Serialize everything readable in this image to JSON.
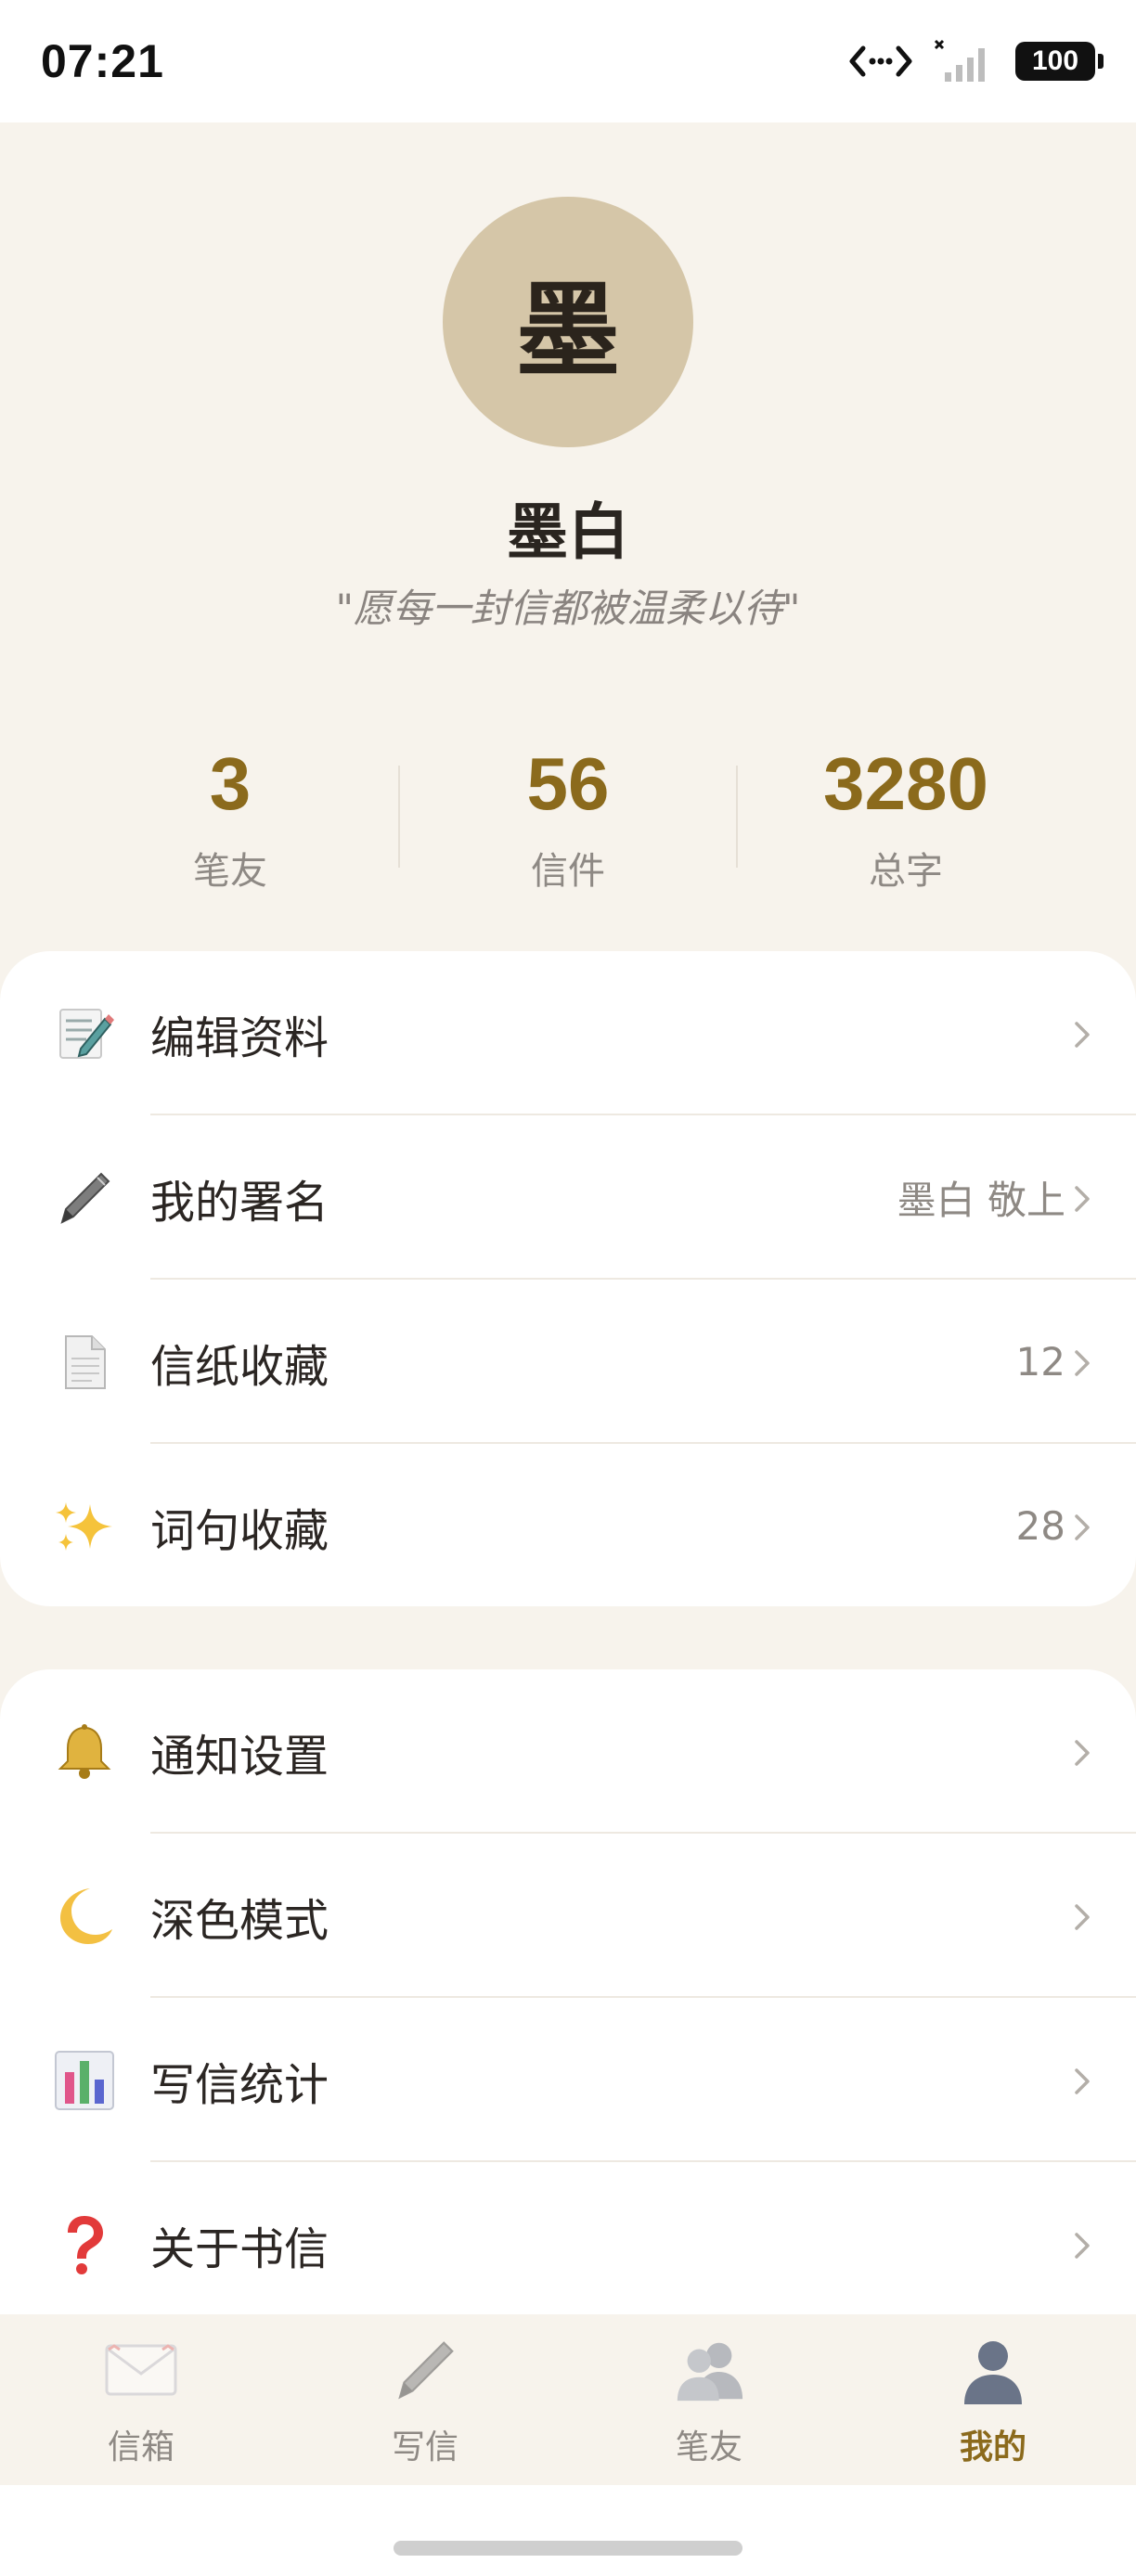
{
  "status_bar": {
    "time": "07:21",
    "battery": "100"
  },
  "profile": {
    "avatar_char": "墨",
    "name": "墨白",
    "motto": "\"愿每一封信都被温柔以待\""
  },
  "stats": [
    {
      "value": "3",
      "label": "笔友"
    },
    {
      "value": "56",
      "label": "信件"
    },
    {
      "value": "3280",
      "label": "总字"
    }
  ],
  "menu_group_1": [
    {
      "icon": "memo-icon",
      "label": "编辑资料",
      "value": ""
    },
    {
      "icon": "pen-icon",
      "label": "我的署名",
      "value": "墨白 敬上"
    },
    {
      "icon": "page-icon",
      "label": "信纸收藏",
      "value": "12"
    },
    {
      "icon": "sparkles-icon",
      "label": "词句收藏",
      "value": "28"
    }
  ],
  "menu_group_2": [
    {
      "icon": "bell-icon",
      "label": "通知设置",
      "value": ""
    },
    {
      "icon": "moon-icon",
      "label": "深色模式",
      "value": ""
    },
    {
      "icon": "bar-chart-icon",
      "label": "写信统计",
      "value": ""
    },
    {
      "icon": "question-icon",
      "label": "关于书信",
      "value": ""
    }
  ],
  "bottom_nav": [
    {
      "icon": "envelope-icon",
      "label": "信箱",
      "active": false
    },
    {
      "icon": "pen-icon",
      "label": "写信",
      "active": false
    },
    {
      "icon": "people-icon",
      "label": "笔友",
      "active": false
    },
    {
      "icon": "person-icon",
      "label": "我的",
      "active": true
    }
  ],
  "colors": {
    "accent": "#8b6a1c",
    "background": "#f7f3ec",
    "avatar": "#d5c6a8"
  }
}
